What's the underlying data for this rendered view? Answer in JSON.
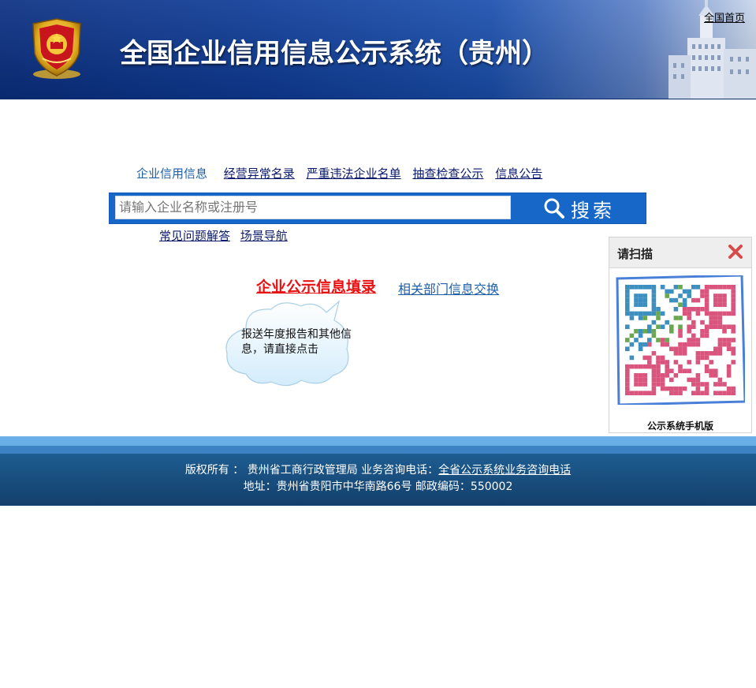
{
  "header": {
    "title": "全国企业信用信息公示系统（贵州）",
    "home_link": "全国首页"
  },
  "tabs": [
    {
      "label": "企业信用信息",
      "active": true
    },
    {
      "label": "经营异常名录",
      "active": false
    },
    {
      "label": "严重违法企业名单",
      "active": false
    },
    {
      "label": "抽查检查公示",
      "active": false
    },
    {
      "label": "信息公告",
      "active": false
    }
  ],
  "search": {
    "placeholder": "请输入企业名称或注册号",
    "button_label": "搜索"
  },
  "sublinks": [
    "常见问题解答",
    "场景导航"
  ],
  "fill_link": "企业公示信息填录",
  "exchange_link": "相关部门信息交换",
  "cloud_text": "报送年度报告和其他信息，请直接点击",
  "qr_panel": {
    "title": "请扫描",
    "caption": "公示系统手机版"
  },
  "footer": {
    "copyright_label": "版权所有 ：",
    "org": "贵州省工商行政管理局",
    "phone_label": "业务咨询电话：",
    "phone_link": "全省公示系统业务咨询电话",
    "address": "地址：贵州省贵阳市中华南路66号",
    "postcode": "邮政编码：550002"
  },
  "colors": {
    "header_blue": "#0e3c98",
    "search_blue": "#1667c8",
    "fill_red": "#e81010",
    "footer_blue": "#143f6b",
    "link_navy": "#0a1a6e"
  }
}
